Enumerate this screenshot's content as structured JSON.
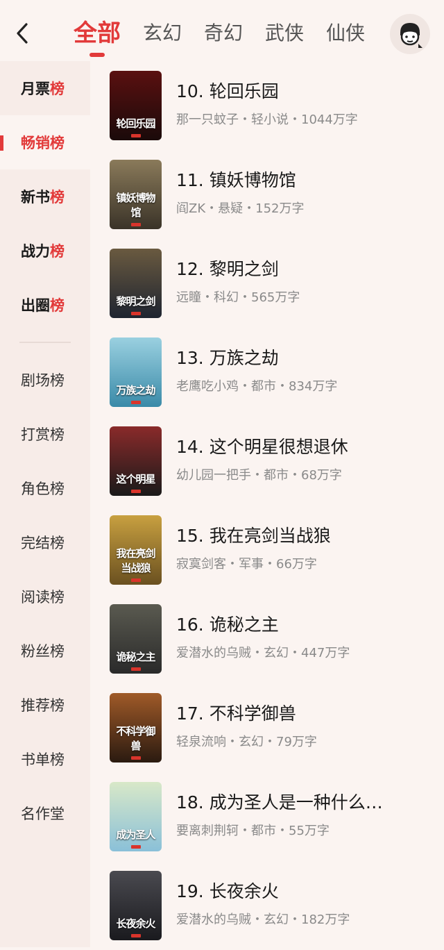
{
  "header": {
    "tabs": [
      {
        "label": "全部",
        "active": true
      },
      {
        "label": "玄幻",
        "active": false
      },
      {
        "label": "奇幻",
        "active": false
      },
      {
        "label": "武侠",
        "active": false
      },
      {
        "label": "仙侠",
        "active": false
      }
    ],
    "back_icon": "chevron-left-icon",
    "profile_icon": "avatar-icon"
  },
  "sidebar": {
    "primary": [
      {
        "head": "月票",
        "tail": "榜",
        "active": false
      },
      {
        "head": "畅销",
        "tail": "榜",
        "active": true
      },
      {
        "head": "新书",
        "tail": "榜",
        "active": false
      },
      {
        "head": "战力",
        "tail": "榜",
        "active": false
      },
      {
        "head": "出圈",
        "tail": "榜",
        "active": false
      }
    ],
    "secondary": [
      "剧场榜",
      "打赏榜",
      "角色榜",
      "完结榜",
      "阅读榜",
      "粉丝榜",
      "推荐榜",
      "书单榜",
      "名作堂"
    ]
  },
  "books": [
    {
      "title": "10. 轮回乐园",
      "meta": "那一只蚊子・轻小说・1044万字",
      "cover_text": "轮回乐园",
      "cover_colors": [
        "#1a0a0a",
        "#5a1010"
      ]
    },
    {
      "title": "11. 镇妖博物馆",
      "meta": "阎ZK・悬疑・152万字",
      "cover_text": "镇妖博物馆",
      "cover_colors": [
        "#3a3328",
        "#8a7a5a"
      ]
    },
    {
      "title": "12. 黎明之剑",
      "meta": "远瞳・科幻・565万字",
      "cover_text": "黎明之剑",
      "cover_colors": [
        "#1e2430",
        "#6a5a40"
      ]
    },
    {
      "title": "13. 万族之劫",
      "meta": "老鹰吃小鸡・都市・834万字",
      "cover_text": "万族之劫",
      "cover_colors": [
        "#3a8aa8",
        "#9ad0e0"
      ]
    },
    {
      "title": "14. 这个明星很想退休",
      "meta": "幼儿园一把手・都市・68万字",
      "cover_text": "这个明星",
      "cover_colors": [
        "#1a1a1a",
        "#8a2a2a"
      ]
    },
    {
      "title": "15. 我在亮剑当战狼",
      "meta": "寂寞剑客・军事・66万字",
      "cover_text": "我在亮剑当战狼",
      "cover_colors": [
        "#6a5020",
        "#c8a040"
      ]
    },
    {
      "title": "16. 诡秘之主",
      "meta": "爱潜水的乌贼・玄幻・447万字",
      "cover_text": "诡秘之主",
      "cover_colors": [
        "#2a2a2a",
        "#5a5a50"
      ]
    },
    {
      "title": "17. 不科学御兽",
      "meta": "轻泉流响・玄幻・79万字",
      "cover_text": "不科学御兽",
      "cover_colors": [
        "#2a1a10",
        "#a05a28"
      ]
    },
    {
      "title": "18. 成为圣人是一种什么…",
      "meta": "要离刺荆轲・都市・55万字",
      "cover_text": "成为圣人",
      "cover_colors": [
        "#8ac0d8",
        "#d8e8c8"
      ]
    },
    {
      "title": "19. 长夜余火",
      "meta": "爱潜水的乌贼・玄幻・182万字",
      "cover_text": "长夜余火",
      "cover_colors": [
        "#1a1a1e",
        "#4a4a50"
      ]
    }
  ],
  "colors": {
    "accent": "#e23a3a",
    "background": "#fbf4f1",
    "sidebar": "#f7ece8"
  }
}
